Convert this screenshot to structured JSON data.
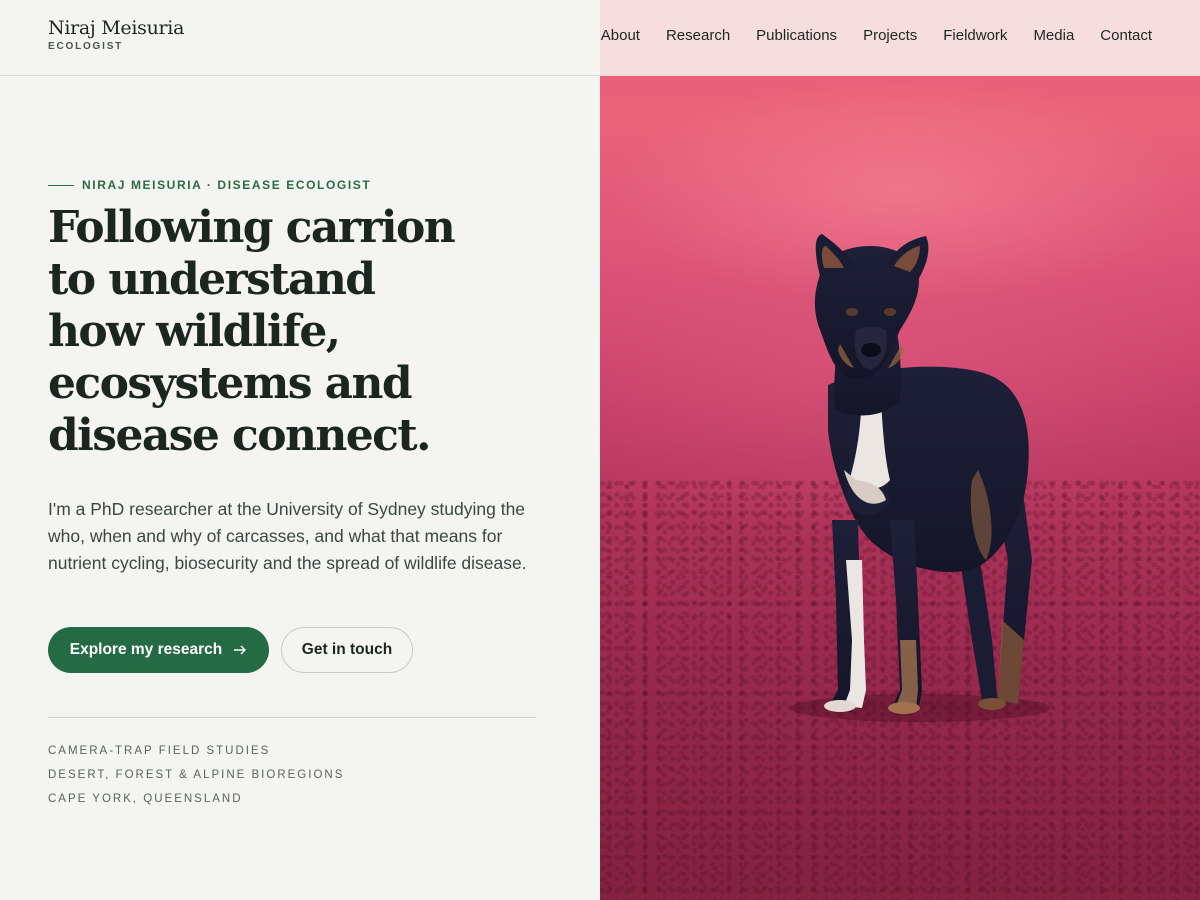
{
  "brand": {
    "name": "Niraj Meisuria",
    "role": "ECOLOGIST"
  },
  "nav": {
    "items": [
      {
        "label": "About"
      },
      {
        "label": "Research"
      },
      {
        "label": "Publications"
      },
      {
        "label": "Projects"
      },
      {
        "label": "Fieldwork"
      },
      {
        "label": "Media"
      },
      {
        "label": "Contact"
      }
    ]
  },
  "hero": {
    "eyebrow": "NIRAJ MEISURIA · DISEASE ECOLOGIST",
    "headline_lines": [
      "Following carrion",
      "to understand",
      "how wildlife,",
      "ecosystems and",
      "disease connect."
    ],
    "lede": "I'm a PhD researcher at the University of Sydney studying the who, when and why of carcasses, and what that means for nutrient cycling, biosecurity and the spread of wildlife disease.",
    "primary_button": "Explore my research",
    "primary_button_icon": "arrow-right-icon",
    "secondary_button": "Get in touch",
    "facts": [
      "CAMERA-TRAP FIELD STUDIES",
      "DESERT, FOREST & ALPINE BIOREGIONS",
      "CAPE YORK, QUEENSLAND"
    ]
  },
  "colors": {
    "accent": "#246b45",
    "background": "#f4f5f0",
    "text": "#1c2620"
  }
}
